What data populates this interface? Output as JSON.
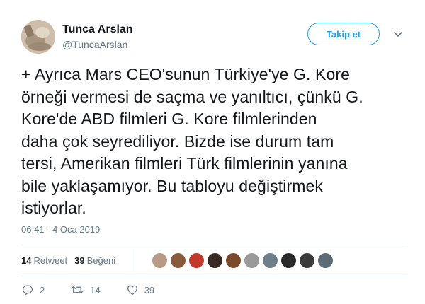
{
  "user": {
    "name": "Tunca Arslan",
    "handle": "@TuncaArslan",
    "avatar_icon": "profile-photo"
  },
  "follow_button": {
    "label": "Takip et"
  },
  "tweet": {
    "text": "+ Ayrıca Mars CEO'sunun Türkiye'ye G. Kore\nörneği vermesi de saçma ve yanıltıcı, çünkü G.\nKore'de ABD filmleri G. Kore filmlerinden\ndaha çok seyrediliyor. Bizde ise durum tam\ntersi, Amerikan filmleri Türk filmlerinin yanına\nbile yaklaşamıyor. Bu tabloyu değiştirmek\nistiyorlar.",
    "timestamp": "06:41 - 4 Oca 2019"
  },
  "stats": {
    "retweets_count": "14",
    "retweets_label": "Retweet",
    "likes_count": "39",
    "likes_label": "Beğeni"
  },
  "likers": [
    {
      "color": "#b89a86"
    },
    {
      "color": "#8a5b3a"
    },
    {
      "color": "#c0392b"
    },
    {
      "color": "#3b2a22"
    },
    {
      "color": "#7a4a2a"
    },
    {
      "color": "#9a9a9a"
    },
    {
      "color": "#6e7f8a"
    },
    {
      "color": "#2a2a2a"
    },
    {
      "color": "#3a3a3a"
    },
    {
      "color": "#5c6b76"
    }
  ],
  "actions": {
    "reply_count": "2",
    "retweet_count": "14",
    "like_count": "39"
  },
  "colors": {
    "accent": "#1da1f2",
    "secondary_text": "#657786",
    "divider": "#e6ecf0"
  }
}
